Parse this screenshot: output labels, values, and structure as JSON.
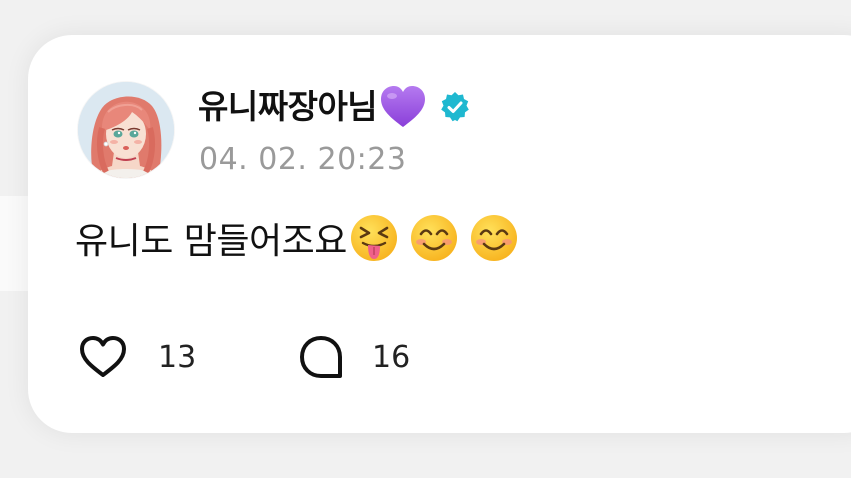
{
  "post": {
    "author": {
      "name": "유니짜장아님",
      "name_emoji": "purple-heart-emoji",
      "verified": true,
      "avatar": "avatar-illustration"
    },
    "timestamp": "04. 02. 20:23",
    "text": "유니도 맘들어조요",
    "emojis": [
      "squinting-face-with-tongue",
      "smiling-face-with-smiling-eyes",
      "smiling-face-with-smiling-eyes"
    ],
    "likes": {
      "icon": "heart-outline-icon",
      "count": "13"
    },
    "comments": {
      "icon": "speech-bubble-icon",
      "count": "16"
    }
  },
  "colors": {
    "verified_badge": "#1fb8d0",
    "heart_emoji": "#9b4fe3",
    "timestamp": "#9a9a9a",
    "text": "#111111"
  }
}
